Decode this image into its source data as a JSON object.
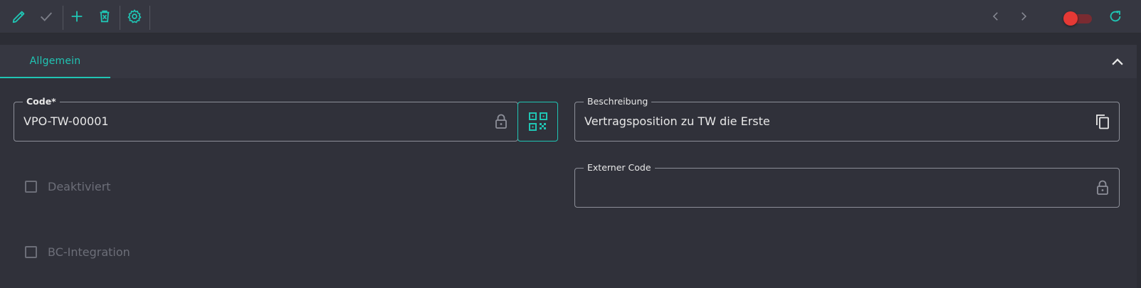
{
  "toolbar": {
    "edit_icon": "pencil-icon",
    "confirm_icon": "check-icon",
    "add_icon": "plus-icon",
    "delete_icon": "trash-icon",
    "settings_icon": "gear-icon",
    "prev_icon": "chevron-left-icon",
    "next_icon": "chevron-right-icon",
    "toggle_state": "off",
    "refresh_icon": "refresh-icon",
    "accent_color": "#20c5b4",
    "toggle_color": "#e53935"
  },
  "tabs": [
    {
      "label": "Allgemein",
      "active": true
    }
  ],
  "form": {
    "code": {
      "label": "Code*",
      "value": "VPO-TW-00001",
      "icon": "lock-icon"
    },
    "qr_button": {
      "icon": "qr-code-icon"
    },
    "beschreibung": {
      "label": "Beschreibung",
      "value": "Vertragsposition zu TW die Erste",
      "icon": "copy-icon"
    },
    "externer_code": {
      "label": "Externer Code",
      "value": "",
      "icon": "lock-icon"
    },
    "deaktiviert": {
      "label": "Deaktiviert",
      "checked": false
    },
    "bc_integration": {
      "label": "BC-Integration",
      "checked": false
    }
  }
}
